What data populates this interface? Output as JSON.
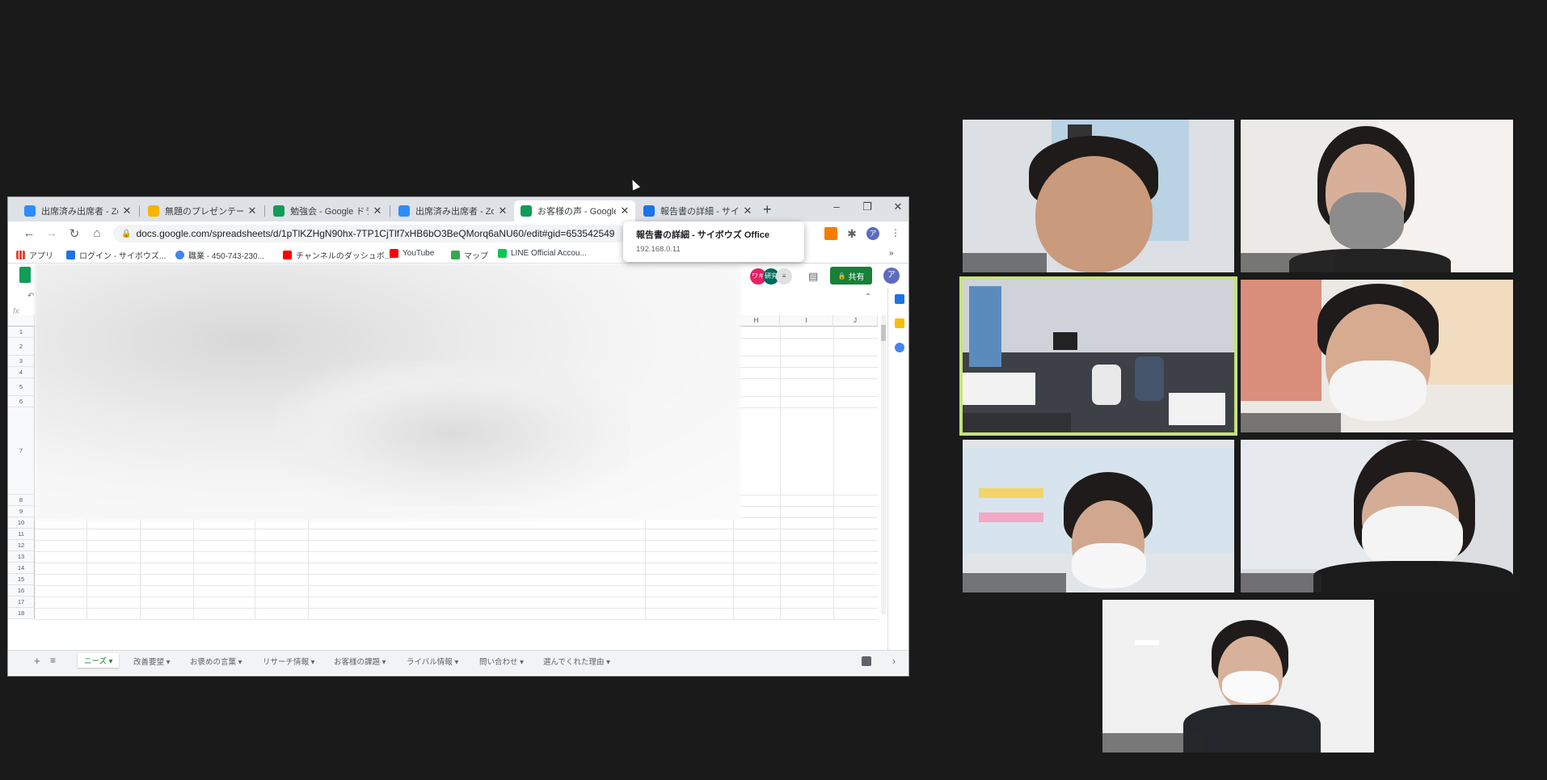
{
  "browser": {
    "tabs": [
      {
        "title": "出席済み出席者 - Zoom",
        "icon_color": "#2d8cff"
      },
      {
        "title": "無題のプレゼンテーション",
        "icon_color": "#f4b400"
      },
      {
        "title": "勉強会 - Google ドライブ",
        "icon_color": "#0f9d58"
      },
      {
        "title": "出席済み出席者 - Zoom",
        "icon_color": "#2d8cff"
      },
      {
        "title": "お客様の声 - Google",
        "icon_color": "#0f9d58"
      },
      {
        "title": "報告書の詳細 - サイボウズ",
        "icon_color": "#1a73e8"
      }
    ],
    "active_tab": 4,
    "new_tab_label": "+",
    "url": "docs.google.com/spreadsheets/d/1pTlKZHgN90hx-7TP1CjTlf7xHB6bO3BeQMorq6aNU60/edit#gid=653542549",
    "bookmarks": [
      {
        "label": "アプリ",
        "icon_color": "#ea4335"
      },
      {
        "label": "ログイン - サイボウズ...",
        "icon_color": "#1a73e8"
      },
      {
        "label": "職業 - 450-743-230...",
        "icon_color": "#4285f4"
      },
      {
        "label": "チャンネルのダッシュボ...",
        "icon_color": "#ff0000"
      },
      {
        "label": "YouTube",
        "icon_color": "#ff0000"
      },
      {
        "label": "マップ",
        "icon_color": "#34a853"
      },
      {
        "label": "LINE Official Accou...",
        "icon_color": "#06c755"
      }
    ],
    "bookmarks_more": "»"
  },
  "sheets": {
    "share_label": "共有",
    "user_initial": "ア",
    "collaborators": [
      "ワキ",
      "研究"
    ],
    "column_letters": [
      "H",
      "I",
      "J"
    ],
    "row_numbers": [
      "1",
      "2",
      "3",
      "4",
      "5",
      "6",
      "7",
      "8",
      "9",
      "10",
      "11",
      "12",
      "13",
      "14",
      "15",
      "16",
      "17",
      "18"
    ],
    "sheet_tabs": [
      "ニーズ",
      "改善要望",
      "お褒めの言葉",
      "リサーチ情報",
      "お客様の課題",
      "ライバル情報",
      "問い合わせ",
      "選んでくれた理由"
    ],
    "active_sheet": 0,
    "fx_label": "fx"
  },
  "tooltip": {
    "title": "報告書の詳細 - サイボウズ Office",
    "url": "192.168.0.11"
  },
  "gallery": {
    "tiles": [
      {
        "name": ""
      },
      {
        "name": ""
      },
      {
        "name": ""
      },
      {
        "name": ""
      },
      {
        "name": ""
      },
      {
        "name": ""
      },
      {
        "name": ""
      }
    ],
    "speaker_highlight": "#c8e27a"
  }
}
